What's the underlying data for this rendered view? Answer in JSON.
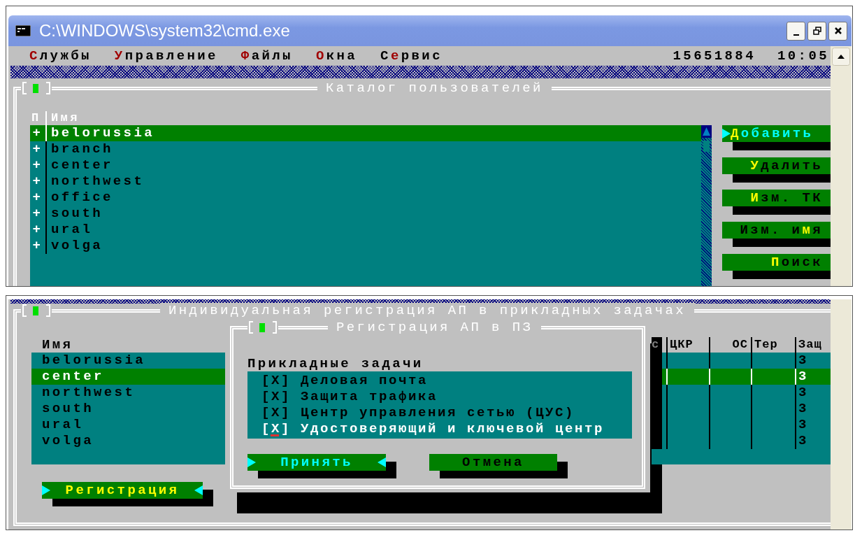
{
  "window": {
    "title": "C:\\WINDOWS\\system32\\cmd.exe"
  },
  "menu": [
    {
      "label": "**С**лужбы"
    },
    {
      "label": "**У**правление"
    },
    {
      "label": "**Ф**айлы"
    },
    {
      "label": "**О**кна"
    },
    {
      "label": "С**е**рвис"
    }
  ],
  "status": {
    "counter": "15651884",
    "time": "10:05"
  },
  "catalog": {
    "title": "Каталог пользователей",
    "columns": [
      "П",
      "Имя"
    ],
    "rows": [
      {
        "mark": "+",
        "name": "belorussia",
        "selected": true
      },
      {
        "mark": "+",
        "name": "branch",
        "selected": false
      },
      {
        "mark": "+",
        "name": "center",
        "selected": false
      },
      {
        "mark": "+",
        "name": "northwest",
        "selected": false
      },
      {
        "mark": "+",
        "name": "office",
        "selected": false
      },
      {
        "mark": "+",
        "name": "south",
        "selected": false
      },
      {
        "mark": "+",
        "name": "ural",
        "selected": false
      },
      {
        "mark": "+",
        "name": "volga",
        "selected": false
      }
    ],
    "buttons": [
      {
        "label": "**Д**обавить",
        "focused": true
      },
      {
        "label": "**У**далить",
        "focused": false
      },
      {
        "label": "**И**зм. ТК",
        "focused": false
      },
      {
        "label": "Изм. и**м**я",
        "focused": false
      },
      {
        "label": "**П**оиск",
        "focused": false
      }
    ]
  },
  "registration": {
    "title": "Индивидуальная регистрация АП в прикладных задачах",
    "name_column": "Имя",
    "columns": [
      "с",
      "ЦКР",
      "ОС",
      "Тер",
      "Защ"
    ],
    "rows": [
      {
        "name": "belorussia",
        "selected": false,
        "column_5": "3"
      },
      {
        "name": "center",
        "selected": true,
        "column_5": "3"
      },
      {
        "name": "northwest",
        "selected": false,
        "column_5": "3"
      },
      {
        "name": "south",
        "selected": false,
        "column_5": "3"
      },
      {
        "name": "ural",
        "selected": false,
        "column_5": "3"
      },
      {
        "name": "volga",
        "selected": false,
        "column_5": "3"
      }
    ],
    "action_button": {
      "label": "Регистрация",
      "focused": true
    }
  },
  "dialog": {
    "title": "Регистрация АП в ПЗ",
    "label": "Прикладные задачи",
    "items": [
      {
        "label": "[X] Деловая почта",
        "focused": false
      },
      {
        "label": "[X] Защита трафика",
        "focused": false
      },
      {
        "label": "[X] Центр управления сетью (ЦУС)",
        "focused": false
      },
      {
        "label": "[X] Удостоверяющий и ключевой центр",
        "focused": true
      }
    ],
    "buttons": [
      {
        "label": "Принять",
        "focused": true
      },
      {
        "label": "Отмена",
        "focused": false
      }
    ]
  }
}
